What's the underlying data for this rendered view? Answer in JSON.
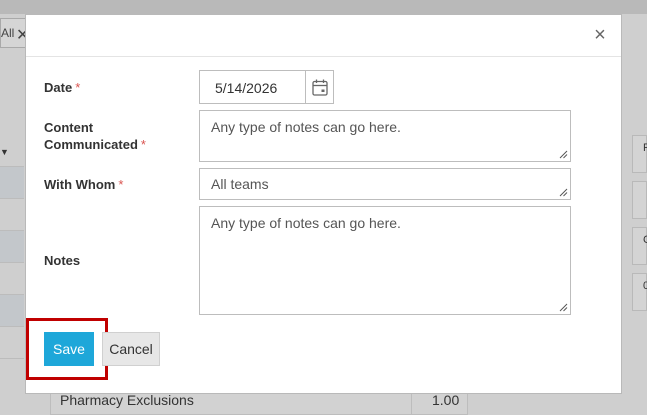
{
  "background": {
    "filter_label": "All",
    "table_row_label": "Pharmacy Exclusions",
    "table_row_value": "1.00",
    "right_col_text": [
      "F",
      "C",
      "0"
    ]
  },
  "modal": {
    "close_icon": "close-icon",
    "fields": {
      "date": {
        "label": "Date",
        "required_mark": "*",
        "value": "5/14/2026",
        "icon": "calendar-icon"
      },
      "content": {
        "label_line1": "Content",
        "label_line2": "Communicated",
        "required_mark": "*",
        "value": "Any type of notes can go here."
      },
      "with_whom": {
        "label": "With Whom",
        "required_mark": "*",
        "value": "All teams"
      },
      "notes": {
        "label": "Notes",
        "value": "Any type of notes can go here."
      }
    },
    "buttons": {
      "save": "Save",
      "cancel": "Cancel"
    }
  },
  "colors": {
    "primary": "#1ea7d9",
    "required": "#d9534f",
    "highlight": "#c00000"
  }
}
